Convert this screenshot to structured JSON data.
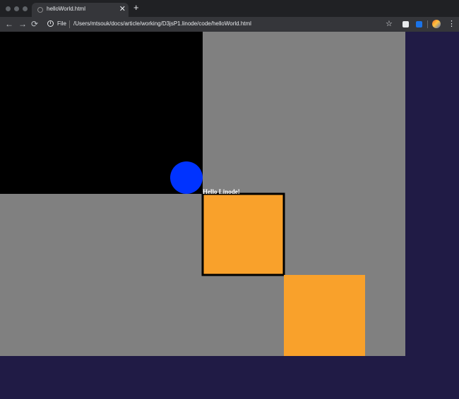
{
  "browser": {
    "tab": {
      "title": "helloWorld.html",
      "close_glyph": "✕"
    },
    "new_tab_glyph": "+",
    "nav": {
      "back_glyph": "←",
      "forward_glyph": "→",
      "reload_glyph": "⟳"
    },
    "address": {
      "info_glyph": "i",
      "scheme": "File",
      "url": "/Users/mtsouk/docs/article/working/D3jsP1.linode/code/helloWorld.html"
    },
    "bookmark_glyph": "☆",
    "menu_glyph": "⋮",
    "icons": [
      "info-icon",
      "star-icon",
      "extension-icon",
      "translate-icon",
      "profile-avatar",
      "kebab-menu-icon"
    ]
  },
  "page": {
    "text_label": "Hello Linode!",
    "colors": {
      "page_bg": "#201b45",
      "svg_bg": "#808080",
      "black_rect": "#000000",
      "circle": "#0033ff",
      "square": "#f9a12b",
      "square_border": "#000000",
      "text": "#ffffff"
    }
  }
}
